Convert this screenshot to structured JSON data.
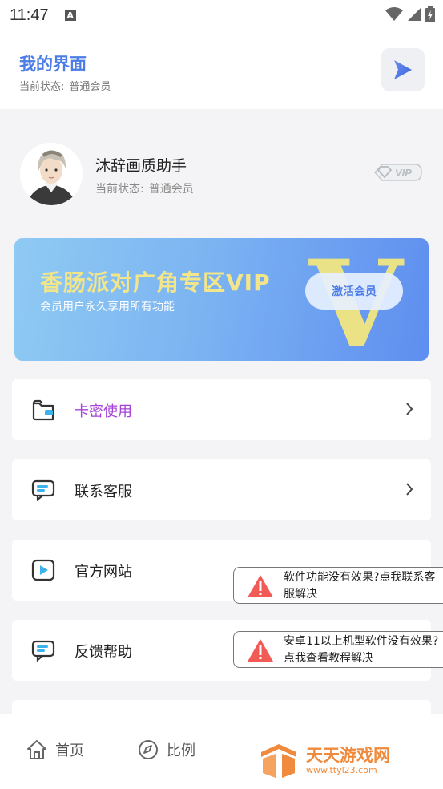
{
  "status_bar": {
    "time": "11:47",
    "notif_icon_letter": "A"
  },
  "header": {
    "title": "我的界面",
    "status_label": "当前状态:",
    "status_value": "普通会员",
    "play_icon": "play-triangle-icon"
  },
  "profile": {
    "name": "沐辞画质助手",
    "status_label": "当前状态:",
    "status_value": "普通会员",
    "badge": "VIP"
  },
  "banner": {
    "title": "香肠派对广角专区VIP",
    "subtitle": "会员用户永久享用所有功能",
    "button_label": "激活会员",
    "decor_letter": "V",
    "colors": {
      "title": "#f3e58a",
      "decor": "#f2e680",
      "gradient_start": "#8fcaf3",
      "gradient_end": "#5e8ef0"
    }
  },
  "menu": {
    "items": [
      {
        "label": "卡密使用",
        "icon": "wallet-icon"
      },
      {
        "label": "联系客服",
        "icon": "chat-icon"
      },
      {
        "label": "官方网站",
        "icon": "video-play-icon"
      },
      {
        "label": "反馈帮助",
        "icon": "chat-icon"
      }
    ]
  },
  "toasts": [
    {
      "text": "软件功能没有效果?点我联系客服解决",
      "icon": "warning-icon"
    },
    {
      "text": "安卓11以上机型软件没有效果?点我查看教程解决",
      "icon": "warning-icon"
    }
  ],
  "bottom_nav": {
    "items": [
      {
        "label": "首页",
        "icon": "home-icon"
      },
      {
        "label": "比例",
        "icon": "compass-icon"
      }
    ]
  },
  "watermark": {
    "name": "天天游戏网",
    "url": "www.ttyl23.com"
  },
  "colors": {
    "accent": "#4c7de6",
    "purple": "#a544d6",
    "warning": "#f25a55"
  }
}
